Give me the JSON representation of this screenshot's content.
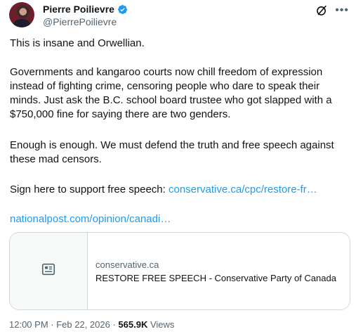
{
  "author": {
    "display_name": "Pierre Poilievre",
    "handle": "@PierrePoilievre"
  },
  "colors": {
    "link": "#1d9bf0",
    "verified": "#1d9bf0",
    "secondary_text": "#536471"
  },
  "icons": {
    "verified": "verified-badge-icon",
    "grok": "grok-icon",
    "more": "more-icon",
    "card_placeholder": "article-icon"
  },
  "tweet": {
    "paragraph_1": "This is insane and Orwellian.",
    "paragraph_2": "Governments and kangaroo courts now chill freedom of expression instead of fighting crime, censoring people who dare to speak their minds. Just ask the B.C. school board trustee who got slapped with a $750,000 fine for saying there are two genders.",
    "paragraph_3": "Enough is enough. We must defend the truth and free speech against these mad censors.",
    "paragraph_4_prefix": "Sign here to support free speech: ",
    "paragraph_4_link": "conservative.ca/cpc/restore-fr…",
    "link_2": "nationalpost.com/opinion/canadi…"
  },
  "card": {
    "domain": "conservative.ca",
    "title": "RESTORE FREE SPEECH - Conservative Party of Canada"
  },
  "meta": {
    "time": "12:00 PM",
    "separator_1": " · ",
    "date": "Feb 22, 2026",
    "separator_2": " · ",
    "views_count": "565.9K",
    "views_label": " Views"
  }
}
